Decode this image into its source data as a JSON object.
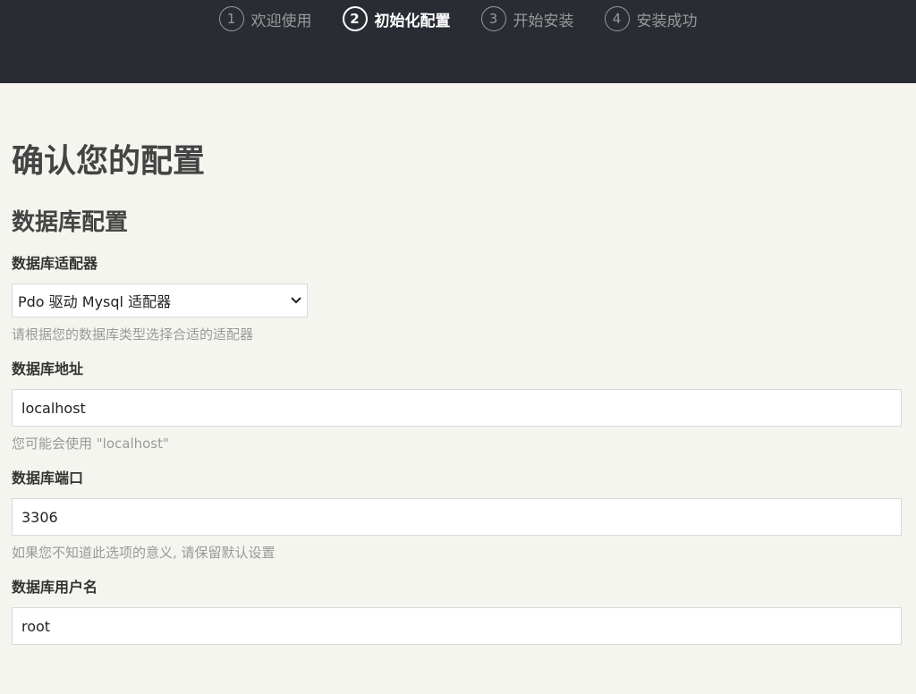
{
  "steps": [
    {
      "num": "1",
      "label": "欢迎使用"
    },
    {
      "num": "2",
      "label": "初始化配置"
    },
    {
      "num": "3",
      "label": "开始安装"
    },
    {
      "num": "4",
      "label": "安装成功"
    }
  ],
  "page_title": "确认您的配置",
  "section_title": "数据库配置",
  "fields": {
    "adapter": {
      "label": "数据库适配器",
      "value": "Pdo 驱动 Mysql 适配器",
      "hint": "请根据您的数据库类型选择合适的适配器"
    },
    "host": {
      "label": "数据库地址",
      "value": "localhost",
      "hint": "您可能会使用 \"localhost\""
    },
    "port": {
      "label": "数据库端口",
      "value": "3306",
      "hint": "如果您不知道此选项的意义, 请保留默认设置"
    },
    "user": {
      "label": "数据库用户名",
      "value": "root"
    }
  },
  "icons": {
    "select_arrow": "chevron-down-icon"
  }
}
